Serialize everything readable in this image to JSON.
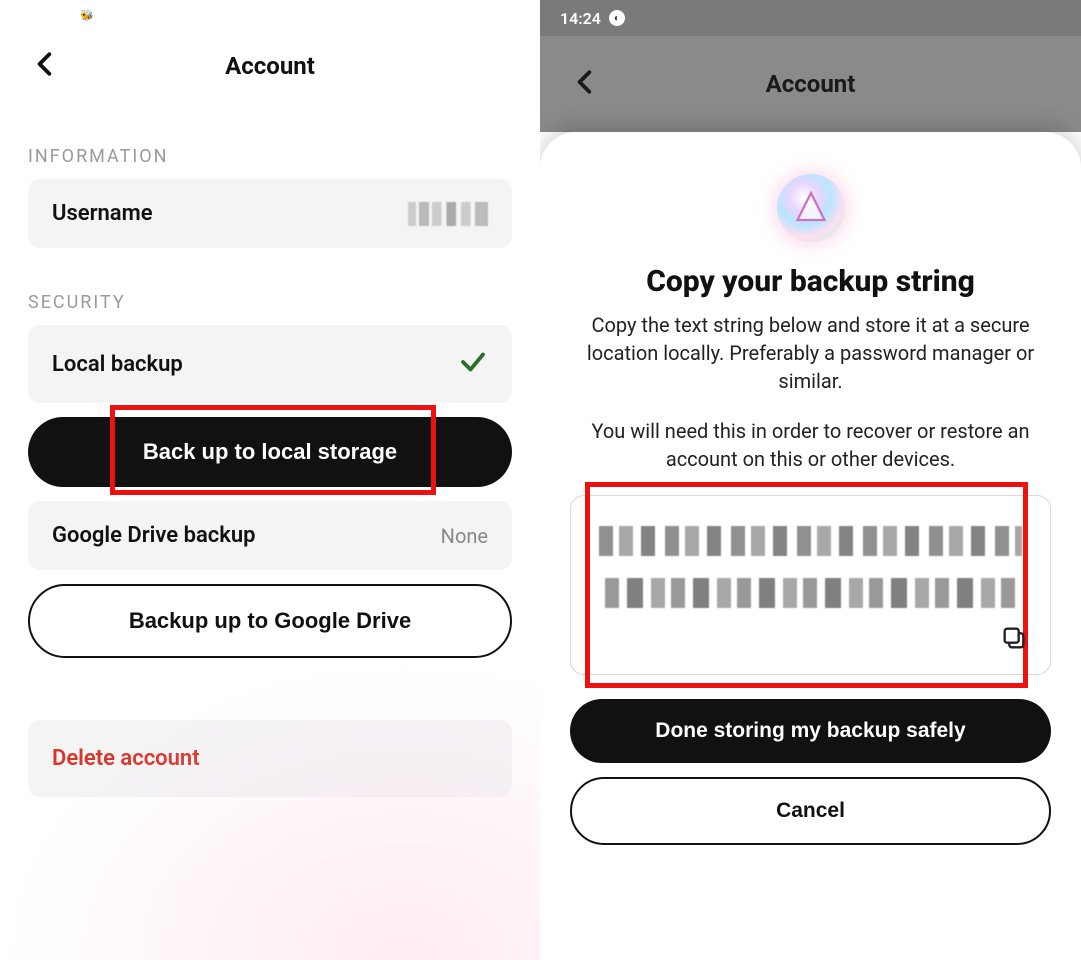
{
  "left": {
    "header": {
      "title": "Account"
    },
    "sections": {
      "information": {
        "label": "INFORMATION",
        "username_row": {
          "label": "Username"
        }
      },
      "security": {
        "label": "SECURITY",
        "local_backup_row": {
          "label": "Local backup"
        },
        "backup_local_btn": "Back up to local storage",
        "gdrive_backup_row": {
          "label": "Google Drive backup",
          "value": "None"
        },
        "backup_gdrive_btn_prefix": "Backup up to ",
        "backup_gdrive_btn_strong": "Google Drive"
      },
      "delete_label": "Delete account"
    }
  },
  "right": {
    "status": {
      "time": "14:24"
    },
    "header": {
      "title": "Account"
    },
    "sheet": {
      "title": "Copy your backup string",
      "desc1": "Copy the text string below and store it at a secure location locally. Preferably a password manager or similar.",
      "desc2": "You will need this in order to recover or restore an account on this or other devices.",
      "done_btn": "Done storing my backup safely",
      "cancel_btn": "Cancel"
    }
  },
  "colors": {
    "accent_red": "#d9362b",
    "highlight": "#e11"
  }
}
